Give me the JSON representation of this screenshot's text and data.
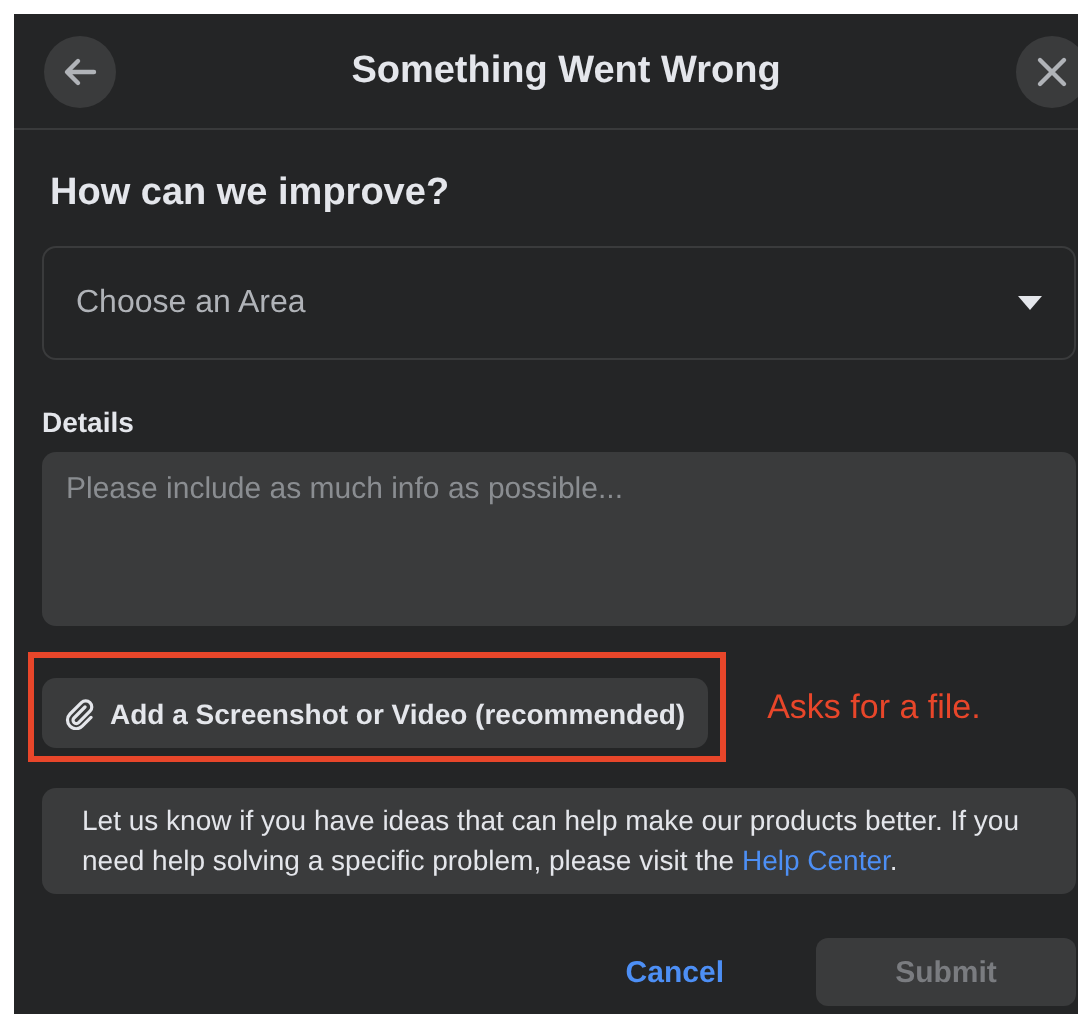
{
  "header": {
    "title": "Something Went Wrong"
  },
  "heading": "How can we improve?",
  "area_select": {
    "placeholder": "Choose an Area"
  },
  "details": {
    "label": "Details",
    "placeholder": "Please include as much info as possible..."
  },
  "attach_button": {
    "label": "Add a Screenshot or Video (recommended)"
  },
  "annotation": {
    "text": "Asks for a file."
  },
  "info": {
    "text": "Let us know if you have ideas that can help make our products better. If you need help solving a specific problem, please visit the ",
    "link": "Help Center",
    "after": "."
  },
  "buttons": [
    {
      "label": "Cancel",
      "kind": "link",
      "disabled": false
    },
    {
      "label": "Submit",
      "kind": "primary",
      "disabled": true
    }
  ]
}
